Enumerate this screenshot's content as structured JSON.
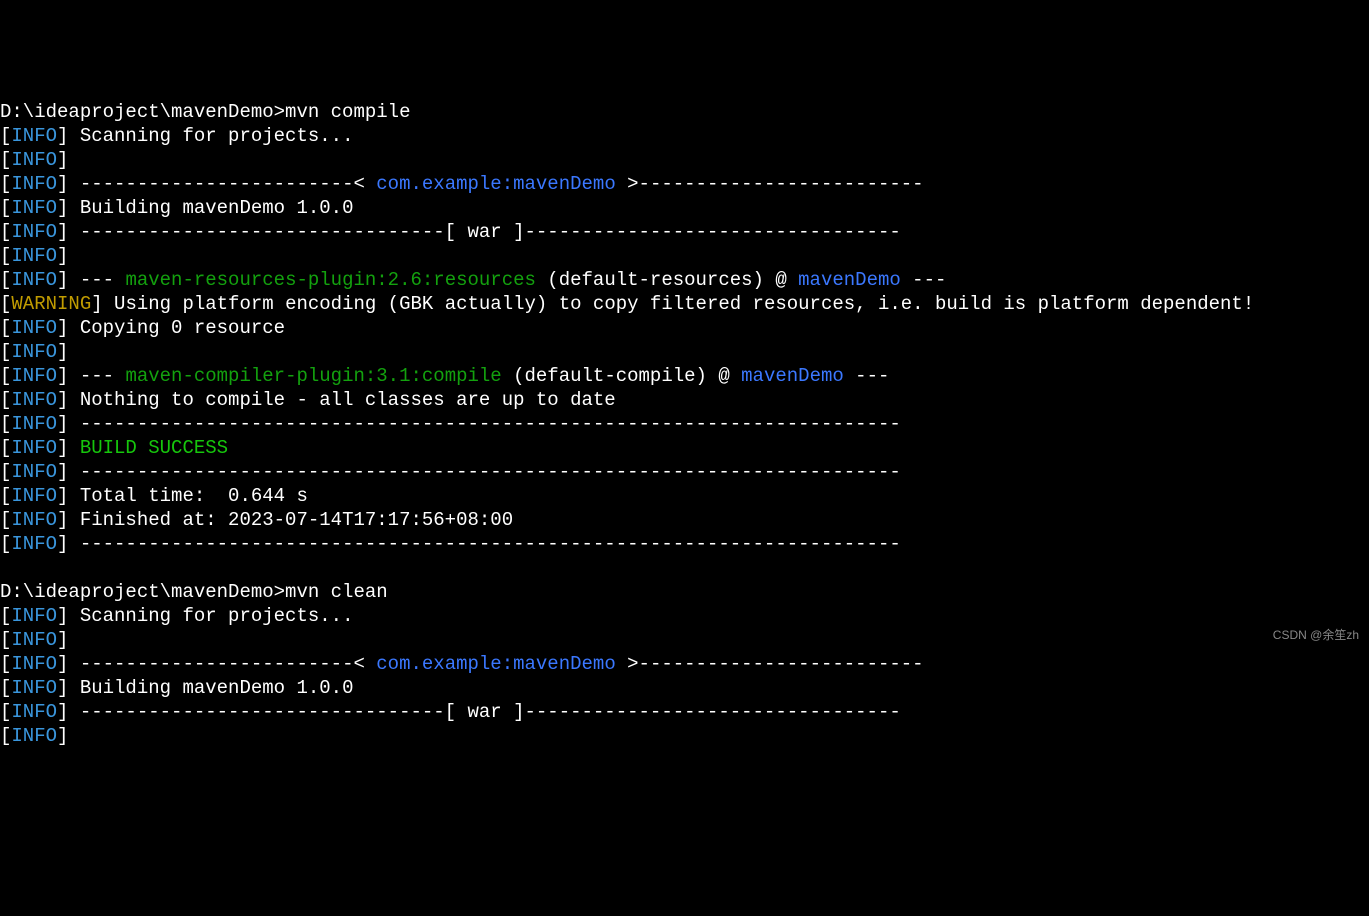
{
  "labels": {
    "info": "INFO",
    "warning": "WARNING"
  },
  "prompt1": {
    "path": "D:\\ideaproject\\mavenDemo>",
    "command": "mvn compile"
  },
  "compile": {
    "scanning": " Scanning for projects...",
    "dash_left": " ------------------------< ",
    "project": "com.example:mavenDemo",
    "dash_right": " >-------------------------",
    "building": " Building mavenDemo 1.0.0",
    "war_line": " --------------------------------[ war ]---------------------------------",
    "plugin1_prefix": " --- ",
    "plugin1": "maven-resources-plugin:2.6:resources",
    "plugin1_mid": " (default-resources) @ ",
    "plugin1_proj": "mavenDemo",
    "plugin1_suffix": " ---",
    "warning_text": " Using platform encoding (GBK actually) to copy filtered resources, i.e. build is platform dependent!",
    "copying": " Copying 0 resource",
    "plugin2_prefix": " --- ",
    "plugin2": "maven-compiler-plugin:3.1:compile",
    "plugin2_mid": " (default-compile) @ ",
    "plugin2_proj": "mavenDemo",
    "plugin2_suffix": " ---",
    "nothing": " Nothing to compile - all classes are up to date",
    "rule": " ------------------------------------------------------------------------",
    "success": " BUILD SUCCESS",
    "total_time": " Total time:  0.644 s",
    "finished": " Finished at: 2023-07-14T17:17:56+08:00"
  },
  "prompt2": {
    "path": "D:\\ideaproject\\mavenDemo>",
    "command": "mvn clean"
  },
  "clean": {
    "scanning": " Scanning for projects...",
    "dash_left": " ------------------------< ",
    "project": "com.example:mavenDemo",
    "dash_right": " >-------------------------",
    "building": " Building mavenDemo 1.0.0",
    "war_line": " --------------------------------[ war ]---------------------------------"
  },
  "watermark": "CSDN @余笙zh"
}
